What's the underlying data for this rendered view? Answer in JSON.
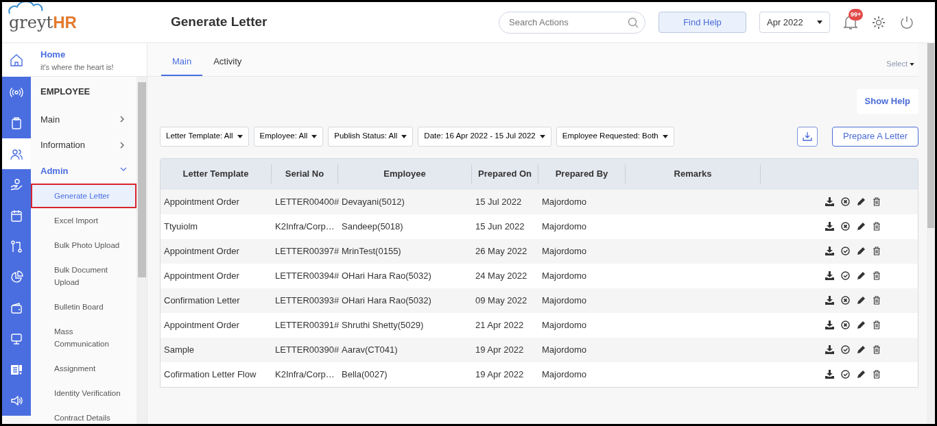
{
  "header": {
    "logo_text": "greyt",
    "logo_accent": "HR",
    "page_title": "Generate Letter",
    "search": {
      "placeholder": "Search Actions"
    },
    "find_help": "Find Help",
    "period": "Apr 2022",
    "notification_badge": "99+"
  },
  "home": {
    "title": "Home",
    "subtitle": "it's where the heart is!"
  },
  "nav_rail": [
    {
      "selected": false
    },
    {
      "selected": false
    },
    {
      "selected": true
    },
    {
      "selected": false
    },
    {
      "selected": false
    },
    {
      "selected": false
    },
    {
      "selected": false
    },
    {
      "selected": false
    },
    {
      "selected": false
    },
    {
      "selected": false
    },
    {
      "selected": false
    }
  ],
  "sidebar": {
    "section": "EMPLOYEE",
    "items": [
      {
        "label": "Main",
        "expanded": false
      },
      {
        "label": "Information",
        "expanded": false
      },
      {
        "label": "Admin",
        "expanded": true,
        "children": [
          {
            "label": "Generate Letter",
            "selected": true
          },
          {
            "label": "Excel Import",
            "selected": false
          },
          {
            "label": "Bulk Photo Upload",
            "selected": false
          },
          {
            "label": "Bulk Document Upload",
            "selected": false
          },
          {
            "label": "Bulletin Board",
            "selected": false
          },
          {
            "label": "Mass Communication",
            "selected": false
          },
          {
            "label": "Assignment",
            "selected": false
          },
          {
            "label": "Identity Verification",
            "selected": false
          },
          {
            "label": "Contract Details",
            "selected": false
          }
        ]
      }
    ]
  },
  "tabs": [
    {
      "label": "Main",
      "selected": true
    },
    {
      "label": "Activity",
      "selected": false
    }
  ],
  "select_menu": "Select",
  "show_help": "Show Help",
  "filters": [
    "Letter Template: All",
    "Employee: All",
    "Publish Status: All",
    "Date: 16 Apr 2022 - 15 Jul 2022",
    "Employee Requested: Both"
  ],
  "prepare_button": "Prepare A Letter",
  "table": {
    "columns": [
      "Letter Template",
      "Serial No",
      "Employee",
      "Prepared On",
      "Prepared By",
      "Remarks"
    ],
    "rows": [
      {
        "cells": [
          "Appointment Order",
          "LETTER00400#",
          "Devayani(5012)",
          "15 Jul 2022",
          "Majordomo",
          ""
        ],
        "published": false
      },
      {
        "cells": [
          "Ttyuiolm",
          "K2Infra/Corp…",
          "Sandeep(5018)",
          "15 Jun 2022",
          "Majordomo",
          ""
        ],
        "published": false
      },
      {
        "cells": [
          "Appointment Order",
          "LETTER00397#",
          "MrinTest(0155)",
          "26 May 2022",
          "Majordomo",
          ""
        ],
        "published": true
      },
      {
        "cells": [
          "Appointment Order",
          "LETTER00394#",
          "OHari Hara Rao(5032)",
          "24 May 2022",
          "Majordomo",
          ""
        ],
        "published": true
      },
      {
        "cells": [
          "Confirmation Letter",
          "LETTER00393#",
          "OHari Hara Rao(5032)",
          "09 May 2022",
          "Majordomo",
          ""
        ],
        "published": false
      },
      {
        "cells": [
          "Appointment Order",
          "LETTER00391#",
          "Shruthi Shetty(5029)",
          "21 Apr 2022",
          "Majordomo",
          ""
        ],
        "published": false
      },
      {
        "cells": [
          "Sample",
          "LETTER00390#",
          "Aarav(CT041)",
          "19 Apr 2022",
          "Majordomo",
          ""
        ],
        "published": true
      },
      {
        "cells": [
          "Cofirmation Letter Flow",
          "K2Infra/Corp…",
          "Bella(0027)",
          "19 Apr 2022",
          "Majordomo",
          ""
        ],
        "published": true
      }
    ]
  }
}
